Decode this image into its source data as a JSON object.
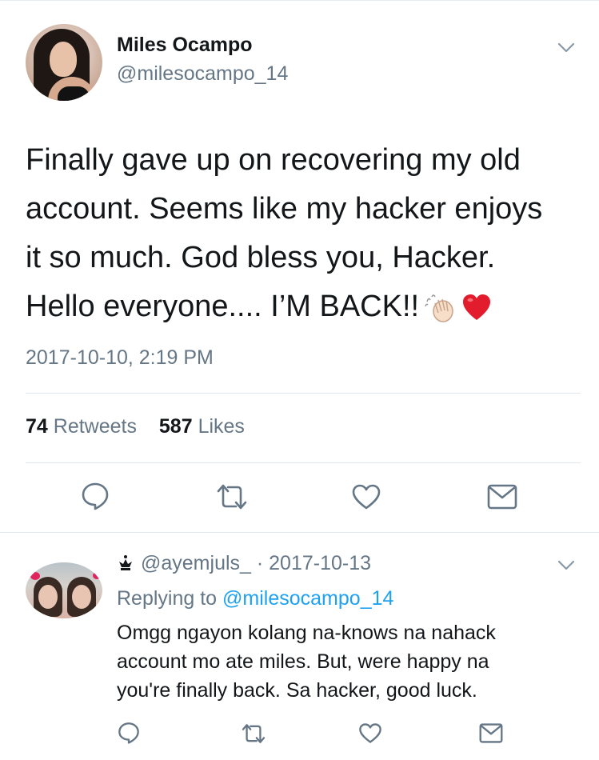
{
  "tweet": {
    "author_name": "Miles Ocampo",
    "author_handle": "@milesocampo_14",
    "text_lines": [
      "Finally gave up on recovering my old",
      "account. Seems like my hacker enjoys",
      "it so much. God bless you, Hacker.",
      "Hello everyone.... I’M BACK!!"
    ],
    "emojis": [
      "waving-hand-icon",
      "red-heart-icon"
    ],
    "timestamp": "2017-10-10, 2:19 PM",
    "stats": {
      "retweets_count": "74",
      "retweets_label": "Retweets",
      "likes_count": "587",
      "likes_label": "Likes"
    },
    "actions": [
      "reply-icon",
      "retweet-icon",
      "like-icon",
      "share-icon"
    ]
  },
  "reply": {
    "header": "@ayemjuls_ · 2017-10-13",
    "replying_prefix": "Replying to",
    "replying_to": "@milesocampo_14",
    "text_lines": [
      "Omgg ngayon kolang na-knows na nahack",
      "account mo ate miles. But,  were happy na",
      "you're finally back. Sa hacker, good luck."
    ],
    "actions": [
      "reply-icon",
      "retweet-icon",
      "like-icon",
      "share-icon"
    ]
  },
  "colors": {
    "text": "#14171a",
    "secondary": "#657786",
    "link": "#1da1f2",
    "icon": "#657786",
    "divider": "#e1e8ed",
    "heart": "#e0245e"
  }
}
